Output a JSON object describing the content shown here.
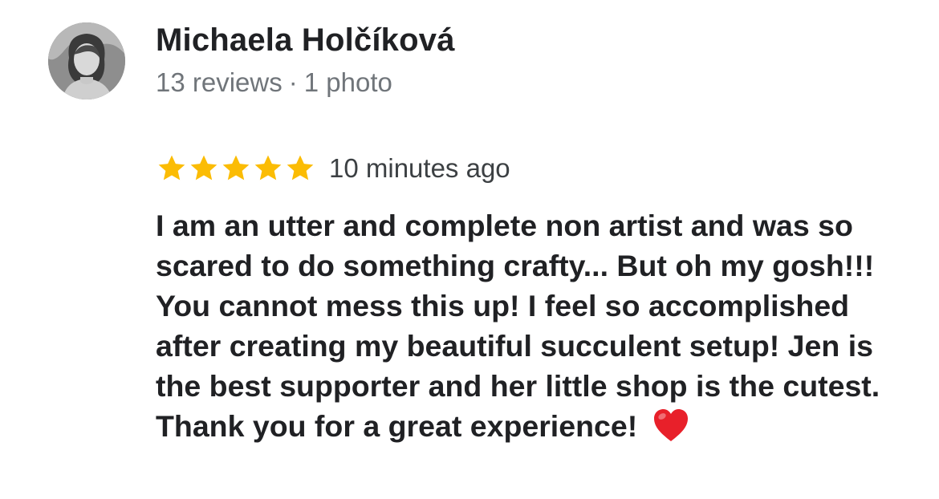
{
  "reviewer": {
    "name": "Michaela Holčíková",
    "reviews_count": "13 reviews",
    "separator": "·",
    "photos_count": "1 photo",
    "avatar_icon": "profile-photo"
  },
  "review": {
    "rating": 5,
    "rating_max": 5,
    "star_color": "#fbbc04",
    "timestamp": "10 minutes ago",
    "text": "I am an utter and complete non artist and was so scared to do something crafty... But oh my gosh!!! You cannot mess this up! I feel so accomplished after creating my beautiful succulent setup! Jen is the best supporter and her little shop is the cutest. Thank you for a great experience!",
    "emoji": "heart-icon",
    "emoji_color": "#e8202a"
  }
}
